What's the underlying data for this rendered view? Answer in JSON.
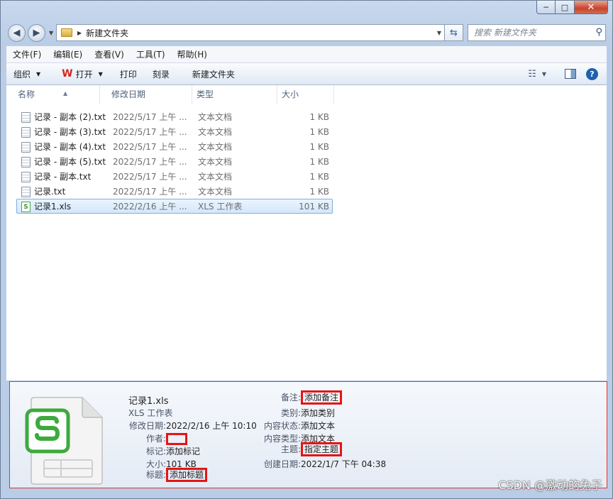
{
  "window": {
    "controls": {
      "minimize": "─",
      "maximize": "□",
      "close": "✕"
    }
  },
  "nav": {
    "back_glyph": "◀",
    "forward_glyph": "▶",
    "address_path": "新建文件夹",
    "search_placeholder": "搜索 新建文件夹"
  },
  "menu": [
    "文件(F)",
    "编辑(E)",
    "查看(V)",
    "工具(T)",
    "帮助(H)"
  ],
  "commands": {
    "organize": "组织",
    "open_with_wps": "打开",
    "print": "打印",
    "burn": "刻录",
    "new_folder": "新建文件夹"
  },
  "columns": {
    "name": "名称",
    "date": "修改日期",
    "type": "类型",
    "size": "大小"
  },
  "files": [
    {
      "name": "记录 - 副本 (2).txt",
      "date": "2022/5/17 上午 ...",
      "type": "文本文档",
      "size": "1 KB",
      "icon": "text-file-icon"
    },
    {
      "name": "记录 - 副本 (3).txt",
      "date": "2022/5/17 上午 ...",
      "type": "文本文档",
      "size": "1 KB",
      "icon": "text-file-icon"
    },
    {
      "name": "记录 - 副本 (4).txt",
      "date": "2022/5/17 上午 ...",
      "type": "文本文档",
      "size": "1 KB",
      "icon": "text-file-icon"
    },
    {
      "name": "记录 - 副本 (5).txt",
      "date": "2022/5/17 上午 ...",
      "type": "文本文档",
      "size": "1 KB",
      "icon": "text-file-icon"
    },
    {
      "name": "记录 - 副本.txt",
      "date": "2022/5/17 上午 ...",
      "type": "文本文档",
      "size": "1 KB",
      "icon": "text-file-icon"
    },
    {
      "name": "记录.txt",
      "date": "2022/5/17 上午 ...",
      "type": "文本文档",
      "size": "1 KB",
      "icon": "text-file-icon"
    },
    {
      "name": "记录1.xls",
      "date": "2022/2/16 上午 ...",
      "type": "XLS 工作表",
      "size": "101 KB",
      "icon": "xls-file-icon",
      "selected": true
    }
  ],
  "details": {
    "filename": "记录1.xls",
    "filetype": "XLS 工作表",
    "left": [
      {
        "label": "修改日期:",
        "value": "2022/2/16 上午 10:10"
      },
      {
        "label": "作者:",
        "value": "",
        "highlight": true
      },
      {
        "label": "标记:",
        "value": "添加标记"
      },
      {
        "label": "大小:",
        "value": "101 KB"
      },
      {
        "label": "标题:",
        "value": "添加标题",
        "highlight": true
      }
    ],
    "right": [
      {
        "label": "备注:",
        "value": "添加备注",
        "highlight": true
      },
      {
        "label": "类别:",
        "value": "添加类别"
      },
      {
        "label": "内容状态:",
        "value": "添加文本"
      },
      {
        "label": "内容类型:",
        "value": "添加文本"
      },
      {
        "label": "主题:",
        "value": "指定主题",
        "highlight": true
      },
      {
        "label": "创建日期:",
        "value": "2022/1/7 下午 04:38"
      }
    ]
  },
  "watermark": "CSDN @激动的兔子",
  "colors": {
    "highlight": "#e61414",
    "selection": "#d4e7fc",
    "wps_red": "#d6241c",
    "xls_green": "#3c9a3c"
  }
}
